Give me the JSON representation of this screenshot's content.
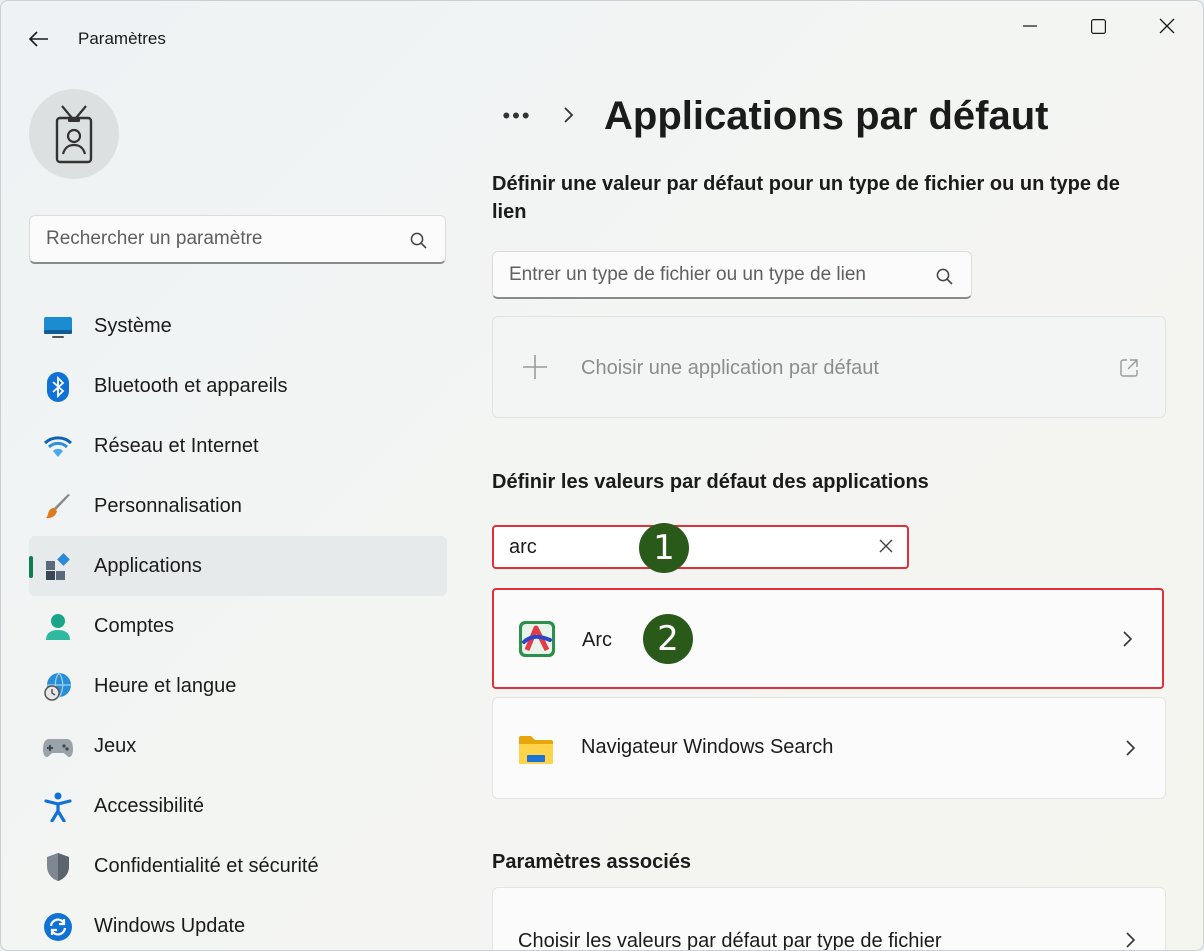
{
  "window": {
    "title": "Paramètres"
  },
  "sidebar": {
    "search_placeholder": "Rechercher un paramètre",
    "items": [
      {
        "label": "Système",
        "icon": "monitor-icon"
      },
      {
        "label": "Bluetooth et appareils",
        "icon": "bluetooth-icon"
      },
      {
        "label": "Réseau et Internet",
        "icon": "wifi-icon"
      },
      {
        "label": "Personnalisation",
        "icon": "brush-icon"
      },
      {
        "label": "Applications",
        "icon": "apps-icon",
        "selected": true
      },
      {
        "label": "Comptes",
        "icon": "account-icon"
      },
      {
        "label": "Heure et langue",
        "icon": "globe-clock-icon"
      },
      {
        "label": "Jeux",
        "icon": "gamepad-icon"
      },
      {
        "label": "Accessibilité",
        "icon": "accessibility-icon"
      },
      {
        "label": "Confidentialité et sécurité",
        "icon": "shield-icon"
      },
      {
        "label": "Windows Update",
        "icon": "update-icon"
      }
    ]
  },
  "main": {
    "breadcrumb_more": "•••",
    "title": "Applications par défaut",
    "filetype_section_title": "Définir une valeur par défaut pour un type de fichier ou un type de lien",
    "filetype_search_placeholder": "Entrer un type de fichier ou un type de lien",
    "choose_default_label": "Choisir une application par défaut",
    "apps_section_title": "Définir les valeurs par défaut des applications",
    "app_search_value": "arc",
    "results": [
      {
        "name": "Arc",
        "icon": "arc-browser-icon"
      },
      {
        "name": "Navigateur Windows Search",
        "icon": "folder-icon"
      }
    ],
    "related_section_title": "Paramètres associés",
    "related_items": [
      {
        "label": "Choisir les valeurs par défaut par type de fichier"
      }
    ]
  },
  "annotations": {
    "step1": "1",
    "step2": "2",
    "highlight_color": "#e0303a",
    "badge_color": "#2a5a1a"
  },
  "colors": {
    "accent": "#0f7b53"
  }
}
